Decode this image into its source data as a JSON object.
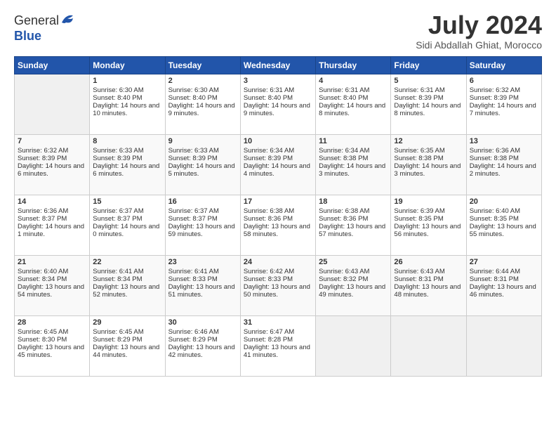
{
  "header": {
    "logo_general": "General",
    "logo_blue": "Blue",
    "title": "July 2024",
    "location": "Sidi Abdallah Ghiat, Morocco"
  },
  "days_of_week": [
    "Sunday",
    "Monday",
    "Tuesday",
    "Wednesday",
    "Thursday",
    "Friday",
    "Saturday"
  ],
  "weeks": [
    [
      {
        "day": "",
        "empty": true
      },
      {
        "day": "1",
        "sunrise": "Sunrise: 6:30 AM",
        "sunset": "Sunset: 8:40 PM",
        "daylight": "Daylight: 14 hours and 10 minutes."
      },
      {
        "day": "2",
        "sunrise": "Sunrise: 6:30 AM",
        "sunset": "Sunset: 8:40 PM",
        "daylight": "Daylight: 14 hours and 9 minutes."
      },
      {
        "day": "3",
        "sunrise": "Sunrise: 6:31 AM",
        "sunset": "Sunset: 8:40 PM",
        "daylight": "Daylight: 14 hours and 9 minutes."
      },
      {
        "day": "4",
        "sunrise": "Sunrise: 6:31 AM",
        "sunset": "Sunset: 8:40 PM",
        "daylight": "Daylight: 14 hours and 8 minutes."
      },
      {
        "day": "5",
        "sunrise": "Sunrise: 6:31 AM",
        "sunset": "Sunset: 8:39 PM",
        "daylight": "Daylight: 14 hours and 8 minutes."
      },
      {
        "day": "6",
        "sunrise": "Sunrise: 6:32 AM",
        "sunset": "Sunset: 8:39 PM",
        "daylight": "Daylight: 14 hours and 7 minutes."
      }
    ],
    [
      {
        "day": "7",
        "sunrise": "Sunrise: 6:32 AM",
        "sunset": "Sunset: 8:39 PM",
        "daylight": "Daylight: 14 hours and 6 minutes."
      },
      {
        "day": "8",
        "sunrise": "Sunrise: 6:33 AM",
        "sunset": "Sunset: 8:39 PM",
        "daylight": "Daylight: 14 hours and 6 minutes."
      },
      {
        "day": "9",
        "sunrise": "Sunrise: 6:33 AM",
        "sunset": "Sunset: 8:39 PM",
        "daylight": "Daylight: 14 hours and 5 minutes."
      },
      {
        "day": "10",
        "sunrise": "Sunrise: 6:34 AM",
        "sunset": "Sunset: 8:39 PM",
        "daylight": "Daylight: 14 hours and 4 minutes."
      },
      {
        "day": "11",
        "sunrise": "Sunrise: 6:34 AM",
        "sunset": "Sunset: 8:38 PM",
        "daylight": "Daylight: 14 hours and 3 minutes."
      },
      {
        "day": "12",
        "sunrise": "Sunrise: 6:35 AM",
        "sunset": "Sunset: 8:38 PM",
        "daylight": "Daylight: 14 hours and 3 minutes."
      },
      {
        "day": "13",
        "sunrise": "Sunrise: 6:36 AM",
        "sunset": "Sunset: 8:38 PM",
        "daylight": "Daylight: 14 hours and 2 minutes."
      }
    ],
    [
      {
        "day": "14",
        "sunrise": "Sunrise: 6:36 AM",
        "sunset": "Sunset: 8:37 PM",
        "daylight": "Daylight: 14 hours and 1 minute."
      },
      {
        "day": "15",
        "sunrise": "Sunrise: 6:37 AM",
        "sunset": "Sunset: 8:37 PM",
        "daylight": "Daylight: 14 hours and 0 minutes."
      },
      {
        "day": "16",
        "sunrise": "Sunrise: 6:37 AM",
        "sunset": "Sunset: 8:37 PM",
        "daylight": "Daylight: 13 hours and 59 minutes."
      },
      {
        "day": "17",
        "sunrise": "Sunrise: 6:38 AM",
        "sunset": "Sunset: 8:36 PM",
        "daylight": "Daylight: 13 hours and 58 minutes."
      },
      {
        "day": "18",
        "sunrise": "Sunrise: 6:38 AM",
        "sunset": "Sunset: 8:36 PM",
        "daylight": "Daylight: 13 hours and 57 minutes."
      },
      {
        "day": "19",
        "sunrise": "Sunrise: 6:39 AM",
        "sunset": "Sunset: 8:35 PM",
        "daylight": "Daylight: 13 hours and 56 minutes."
      },
      {
        "day": "20",
        "sunrise": "Sunrise: 6:40 AM",
        "sunset": "Sunset: 8:35 PM",
        "daylight": "Daylight: 13 hours and 55 minutes."
      }
    ],
    [
      {
        "day": "21",
        "sunrise": "Sunrise: 6:40 AM",
        "sunset": "Sunset: 8:34 PM",
        "daylight": "Daylight: 13 hours and 54 minutes."
      },
      {
        "day": "22",
        "sunrise": "Sunrise: 6:41 AM",
        "sunset": "Sunset: 8:34 PM",
        "daylight": "Daylight: 13 hours and 52 minutes."
      },
      {
        "day": "23",
        "sunrise": "Sunrise: 6:41 AM",
        "sunset": "Sunset: 8:33 PM",
        "daylight": "Daylight: 13 hours and 51 minutes."
      },
      {
        "day": "24",
        "sunrise": "Sunrise: 6:42 AM",
        "sunset": "Sunset: 8:33 PM",
        "daylight": "Daylight: 13 hours and 50 minutes."
      },
      {
        "day": "25",
        "sunrise": "Sunrise: 6:43 AM",
        "sunset": "Sunset: 8:32 PM",
        "daylight": "Daylight: 13 hours and 49 minutes."
      },
      {
        "day": "26",
        "sunrise": "Sunrise: 6:43 AM",
        "sunset": "Sunset: 8:31 PM",
        "daylight": "Daylight: 13 hours and 48 minutes."
      },
      {
        "day": "27",
        "sunrise": "Sunrise: 6:44 AM",
        "sunset": "Sunset: 8:31 PM",
        "daylight": "Daylight: 13 hours and 46 minutes."
      }
    ],
    [
      {
        "day": "28",
        "sunrise": "Sunrise: 6:45 AM",
        "sunset": "Sunset: 8:30 PM",
        "daylight": "Daylight: 13 hours and 45 minutes."
      },
      {
        "day": "29",
        "sunrise": "Sunrise: 6:45 AM",
        "sunset": "Sunset: 8:29 PM",
        "daylight": "Daylight: 13 hours and 44 minutes."
      },
      {
        "day": "30",
        "sunrise": "Sunrise: 6:46 AM",
        "sunset": "Sunset: 8:29 PM",
        "daylight": "Daylight: 13 hours and 42 minutes."
      },
      {
        "day": "31",
        "sunrise": "Sunrise: 6:47 AM",
        "sunset": "Sunset: 8:28 PM",
        "daylight": "Daylight: 13 hours and 41 minutes."
      },
      {
        "day": "",
        "empty": true
      },
      {
        "day": "",
        "empty": true
      },
      {
        "day": "",
        "empty": true
      }
    ]
  ]
}
